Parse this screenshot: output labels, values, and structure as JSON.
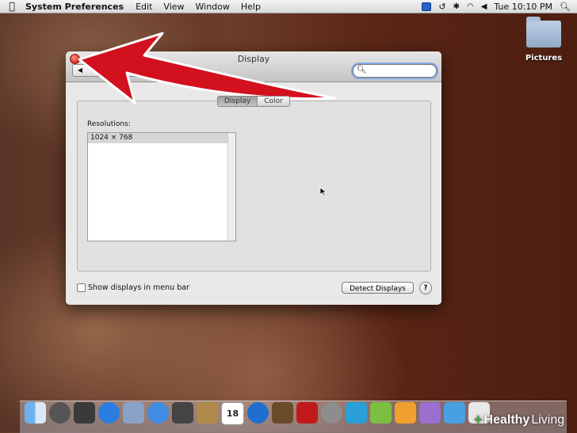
{
  "menubar": {
    "app_name": "System Preferences",
    "items": [
      "Edit",
      "View",
      "Window",
      "Help"
    ],
    "clock": "Tue 10:10 PM",
    "status_icons": [
      "screen-icon",
      "time-machine-icon",
      "bluetooth-icon",
      "wifi-icon",
      "volume-icon"
    ]
  },
  "desktop": {
    "folder_label": "Pictures"
  },
  "window": {
    "title": "Display",
    "search": {
      "value": "",
      "placeholder": ""
    },
    "tabs": [
      {
        "label": "Display",
        "selected": true
      },
      {
        "label": "Color",
        "selected": false
      }
    ],
    "resolutions_label": "Resolutions:",
    "resolutions": [
      "1024 × 768"
    ],
    "show_displays_label": "Show displays in menu bar",
    "show_displays_checked": false,
    "detect_button": "Detect Displays",
    "help_button": "?"
  },
  "dock": {
    "calendar_day": "18",
    "apps": [
      "finder-icon",
      "launchpad-icon",
      "dashboard-icon",
      "app-store-icon",
      "mail-icon",
      "safari-icon",
      "facetime-icon",
      "contacts-icon",
      "calendar-icon",
      "itunes-icon",
      "photo-booth-icon",
      "photos-icon",
      "preferences-icon",
      "word-icon",
      "excel-icon",
      "powerpoint-icon",
      "entourage-icon",
      "messenger-icon",
      "documents-icon",
      "trash-icon"
    ]
  },
  "watermark": {
    "strong": "Healthy",
    "rest": "Living"
  },
  "colors": {
    "arrow": "#d3101e",
    "search_focus": "#7ea7e0",
    "close_button": "#d2291b"
  }
}
